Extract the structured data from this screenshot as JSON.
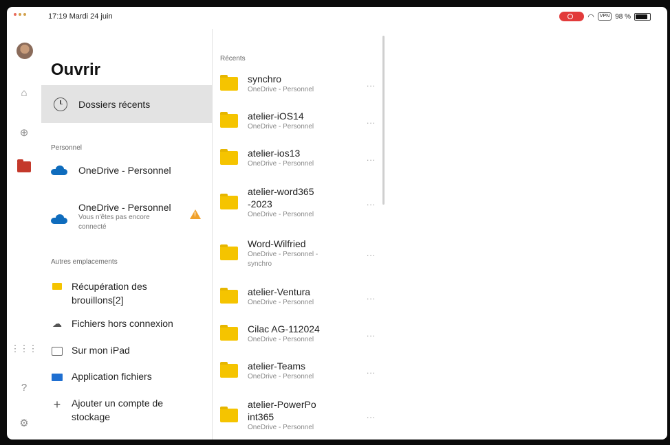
{
  "statusbar": {
    "time_date": "17:19 Mardi 24 juin",
    "vpn": "VPN",
    "battery": "98 %"
  },
  "open": {
    "title": "Ouvrir",
    "recent_folders": "Dossiers récents",
    "personal_label": "Personnel",
    "locations": [
      {
        "title": "OneDrive - Personnel"
      },
      {
        "title": "OneDrive - Personnel",
        "sub": "Vous n'êtes pas encore connecté"
      }
    ],
    "other_label": "Autres emplacements",
    "other": [
      {
        "label": "Récupération des brouillons[2]",
        "icon": "folder-icon"
      },
      {
        "label": "Fichiers hors connexion",
        "icon": "cloud-off-icon"
      },
      {
        "label": "Sur mon iPad",
        "icon": "ipad-icon"
      },
      {
        "label": "Application fichiers",
        "icon": "files-app-icon"
      },
      {
        "label": "Ajouter un compte de stockage",
        "icon": "plus-icon"
      }
    ]
  },
  "recents": {
    "header": "Récents",
    "items": [
      {
        "name": "synchro",
        "location": "OneDrive - Personnel"
      },
      {
        "name": "atelier-iOS14",
        "location": "OneDrive - Personnel"
      },
      {
        "name": "atelier-ios13",
        "location": "OneDrive - Personnel"
      },
      {
        "name": "atelier-word365-2023",
        "location": "OneDrive - Personnel"
      },
      {
        "name": "Word-Wilfried",
        "location": "OneDrive - Personnel - synchro"
      },
      {
        "name": "atelier-Ventura",
        "location": "OneDrive - Personnel"
      },
      {
        "name": "Cilac AG-112024",
        "location": "OneDrive - Personnel"
      },
      {
        "name": "atelier-Teams",
        "location": "OneDrive - Personnel"
      },
      {
        "name": "atelier-PowerPoint365",
        "location": "OneDrive - Personnel"
      }
    ],
    "more": "..."
  },
  "colors": {
    "accent": "#0f6cbd",
    "folder": "#f5c400",
    "selected_bg": "#e3e3e3",
    "warning": "#f0a12c"
  }
}
